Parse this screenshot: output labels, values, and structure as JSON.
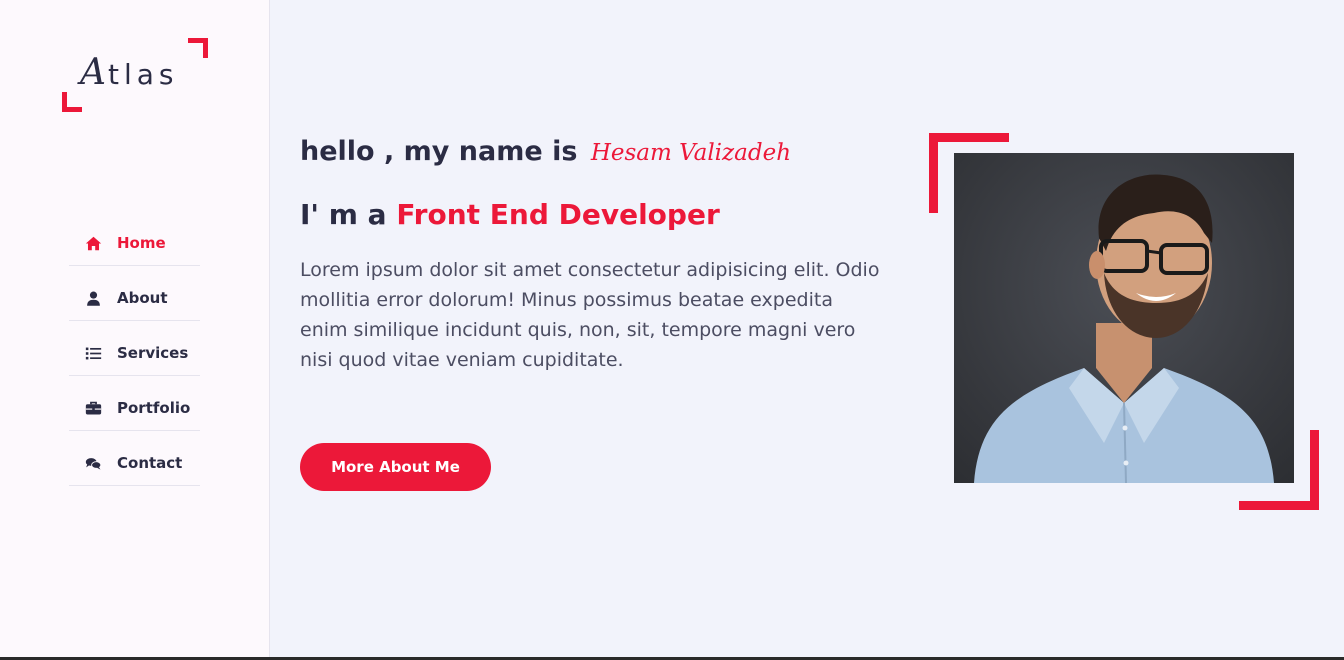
{
  "logo": {
    "first": "A",
    "rest": "tlas"
  },
  "nav": {
    "items": [
      {
        "label": "Home",
        "icon": "home-icon",
        "active": true
      },
      {
        "label": "About",
        "icon": "user-icon",
        "active": false
      },
      {
        "label": "Services",
        "icon": "list-icon",
        "active": false
      },
      {
        "label": "Portfolio",
        "icon": "briefcase-icon",
        "active": false
      },
      {
        "label": "Contact",
        "icon": "comments-icon",
        "active": false
      }
    ]
  },
  "hero": {
    "greeting": "hello , my name is",
    "name": "Hesam Valizadeh",
    "role_prefix": "I' m a",
    "role": "Front End Developer",
    "intro": "Lorem ipsum dolor sit amet consectetur adipisicing elit. Odio mollitia error dolorum! Minus possimus beatae expedita enim similique incidunt quis, non, sit, tempore magni vero nisi quod vitae veniam cupiditate.",
    "button_label": "More About Me"
  },
  "colors": {
    "accent": "#ec1839",
    "text": "#2b2c44",
    "background": "#f2f3fb",
    "sidebar": "#fdf9fd"
  }
}
